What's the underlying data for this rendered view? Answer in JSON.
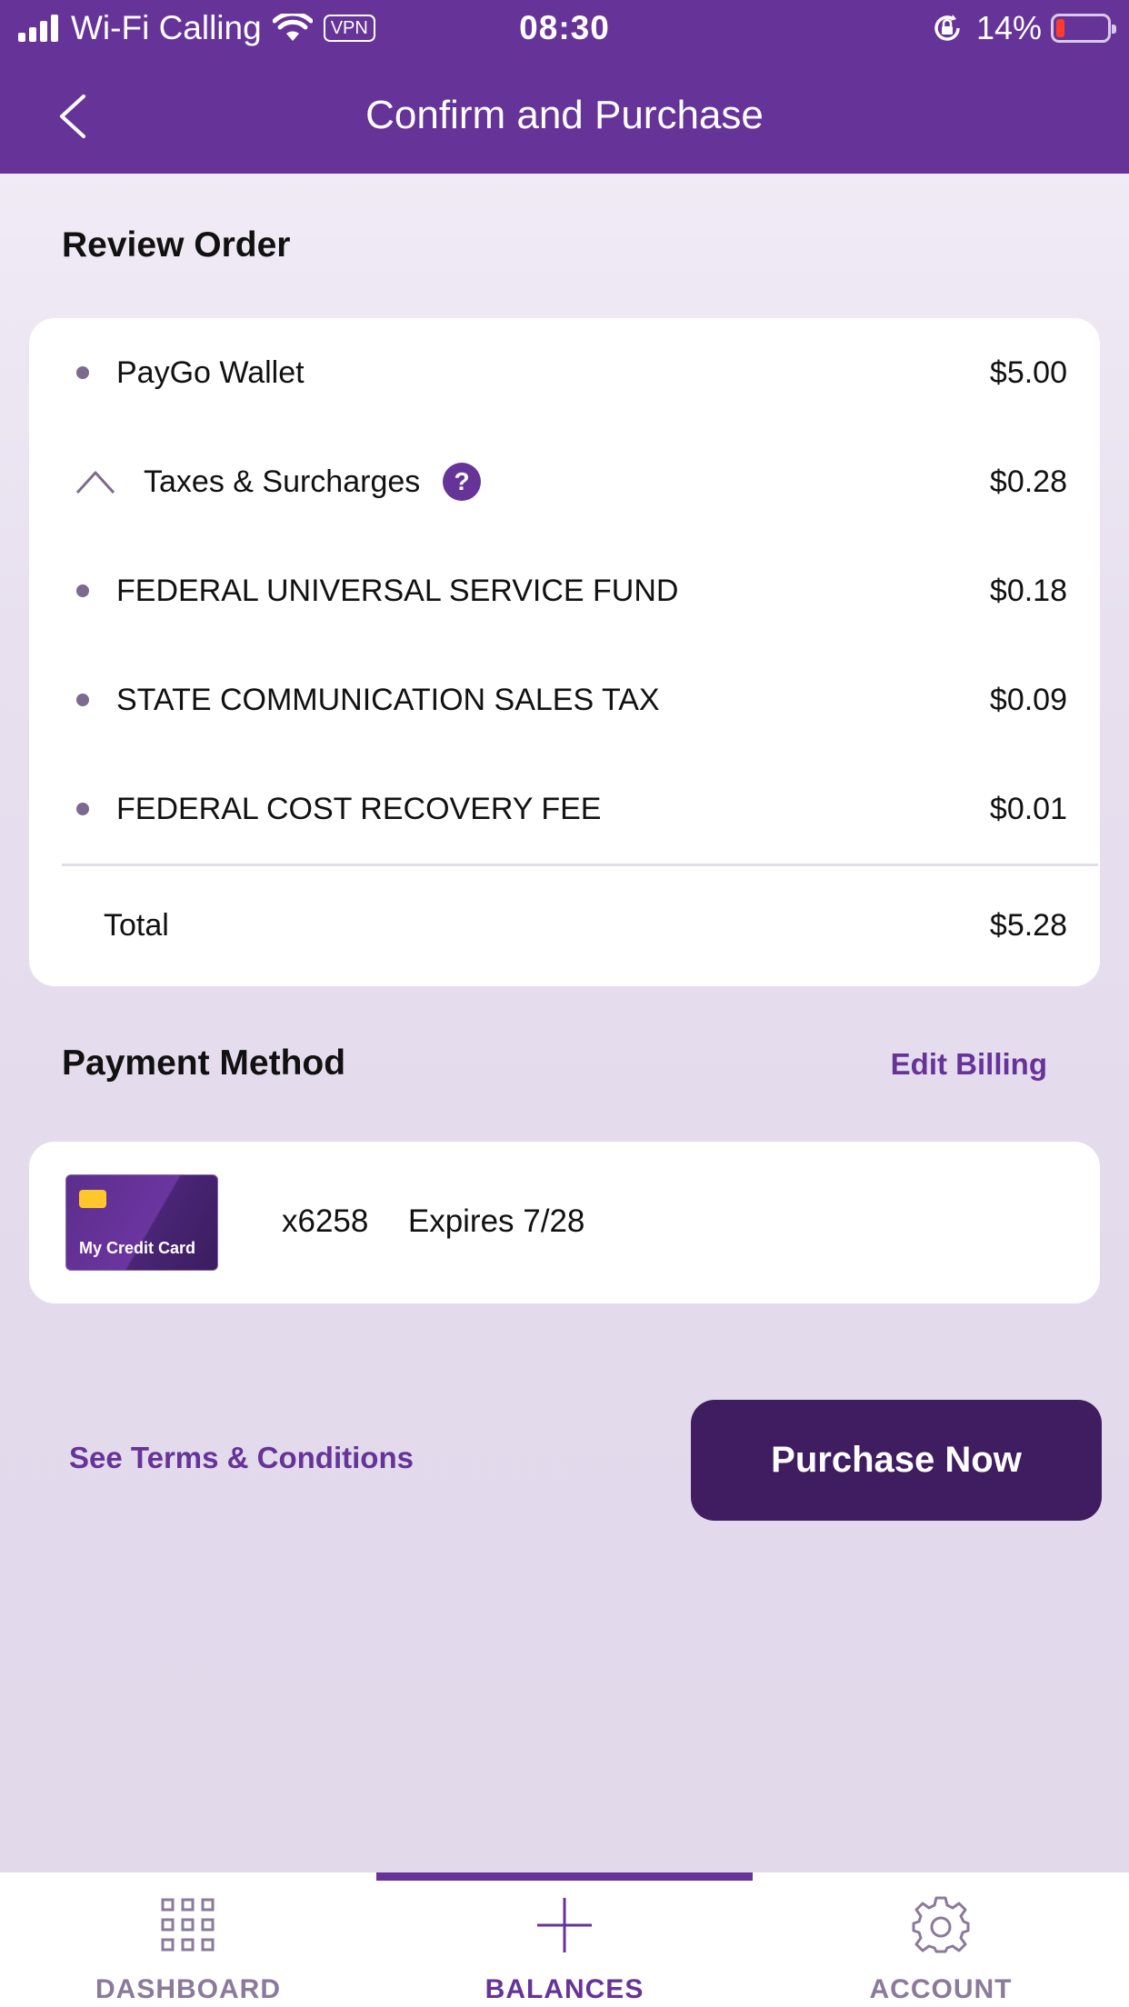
{
  "status_bar": {
    "carrier": "Wi-Fi Calling",
    "vpn": "VPN",
    "time": "08:30",
    "battery": "14%"
  },
  "header": {
    "title": "Confirm and Purchase",
    "back_icon": "chevron-left-icon"
  },
  "review": {
    "title": "Review Order",
    "items": [
      {
        "label": "PayGo Wallet",
        "amount": "$5.00"
      },
      {
        "label": "Taxes & Surcharges",
        "amount": "$0.28",
        "help": "?"
      },
      {
        "label": "FEDERAL UNIVERSAL SERVICE FUND",
        "amount": "$0.18"
      },
      {
        "label": "STATE COMMUNICATION SALES TAX",
        "amount": "$0.09"
      },
      {
        "label": "FEDERAL COST RECOVERY FEE",
        "amount": "$0.01"
      }
    ],
    "total_label": "Total",
    "total_amount": "$5.28"
  },
  "payment": {
    "title": "Payment Method",
    "edit_label": "Edit Billing",
    "card_name": "My Credit Card",
    "card_number": "x6258",
    "card_expiry": "Expires 7/28"
  },
  "actions": {
    "terms_label": "See Terms & Conditions",
    "purchase_label": "Purchase Now"
  },
  "tabbar": {
    "items": [
      {
        "label": "DASHBOARD",
        "icon": "grid-icon"
      },
      {
        "label": "BALANCES",
        "icon": "plus-icon",
        "active": true
      },
      {
        "label": "ACCOUNT",
        "icon": "gear-icon"
      }
    ]
  },
  "colors": {
    "brand": "#663399",
    "button": "#3f1d60",
    "battery_low": "#ff3b30"
  }
}
